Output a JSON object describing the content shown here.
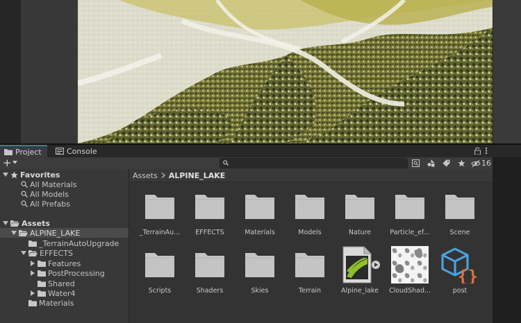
{
  "tabs": [
    {
      "label": "Project",
      "icon": "folder-icon",
      "active": true
    },
    {
      "label": "Console",
      "icon": "console-icon",
      "active": false
    }
  ],
  "toolbar": {
    "add_label": "+",
    "search_placeholder": "",
    "hidden_count": "16"
  },
  "tree": {
    "favorites": {
      "label": "Favorites",
      "items": [
        "All Materials",
        "All Models",
        "All Prefabs"
      ]
    },
    "assets": {
      "label": "Assets",
      "alpine": "ALPINE_LAKE",
      "terrain_upgrade": "_TerrainAutoUpgrade",
      "effects": "EFFECTS",
      "effects_children": [
        "Features",
        "PostProcessing",
        "Shared",
        "Water4"
      ],
      "materials": "Materials"
    }
  },
  "breadcrumb": {
    "root": "Assets",
    "current": "ALPINE_LAKE"
  },
  "assets": [
    {
      "name": "_TerrainAu...",
      "type": "folder"
    },
    {
      "name": "EFFECTS",
      "type": "folder"
    },
    {
      "name": "Materials",
      "type": "folder"
    },
    {
      "name": "Models",
      "type": "folder"
    },
    {
      "name": "Nature",
      "type": "folder"
    },
    {
      "name": "Particle_ef...",
      "type": "folder"
    },
    {
      "name": "Scene",
      "type": "folder"
    },
    {
      "name": "Scripts",
      "type": "folder"
    },
    {
      "name": "Shaders",
      "type": "folder"
    },
    {
      "name": "Skies",
      "type": "folder"
    },
    {
      "name": "Terrain",
      "type": "folder"
    },
    {
      "name": "Alpine_lake",
      "type": "terrain"
    },
    {
      "name": "CloudShad...",
      "type": "texture"
    },
    {
      "name": "post",
      "type": "json"
    }
  ],
  "colors": {
    "accent": "#3a79bb",
    "selection": "#4b4b4b",
    "folder": "#c2c2c2",
    "json": "#e0703a",
    "json_cube": "#4aa3df",
    "terrain": "#8fbf2a"
  }
}
